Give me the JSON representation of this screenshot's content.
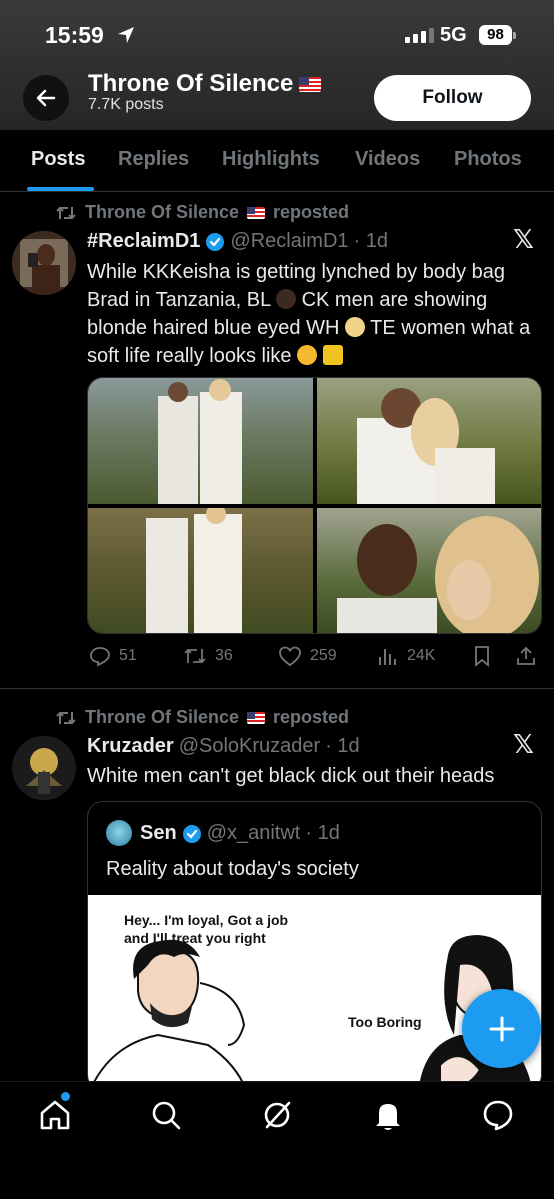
{
  "status_bar": {
    "time": "15:59",
    "network": "5G",
    "battery": "98"
  },
  "profile": {
    "name": "Throne Of Silence",
    "posts": "7.7K posts",
    "follow_label": "Follow",
    "flag_icon": "us-flag-icon"
  },
  "tabs": [
    "Posts",
    "Replies",
    "Highlights",
    "Videos",
    "Photos"
  ],
  "active_tab": "Posts",
  "post1": {
    "repost_label": "Throne Of Silence",
    "repost_suffix": "reposted",
    "name": "#ReclaimD1",
    "handle": "@ReclaimD1",
    "time": "· 1d",
    "text_a": "While KKKeisha is getting lynched by body bag Brad in Tanzania, BL",
    "text_b": "CK men are showing blonde haired blue eyed WH",
    "text_c": "TE women what a soft life really looks like",
    "stats": {
      "replies": "51",
      "reposts": "36",
      "likes": "259",
      "views": "24K"
    }
  },
  "post2": {
    "repost_label": "Throne Of Silence",
    "repost_suffix": "reposted",
    "name": "Kruzader",
    "handle": "@SoloKruzader",
    "time": "· 1d",
    "text": "White men can't get black dick out their heads",
    "quote": {
      "name": "Sen",
      "handle": "@x_anitwt",
      "time": "· 1d",
      "text": "Reality about today's society",
      "comic_left": "Hey... I'm loyal, Got a job and I'll treat you right",
      "comic_right": "Too Boring"
    }
  },
  "colors": {
    "accent": "#1d9bf0",
    "bg": "#000000",
    "muted": "#71767b"
  }
}
